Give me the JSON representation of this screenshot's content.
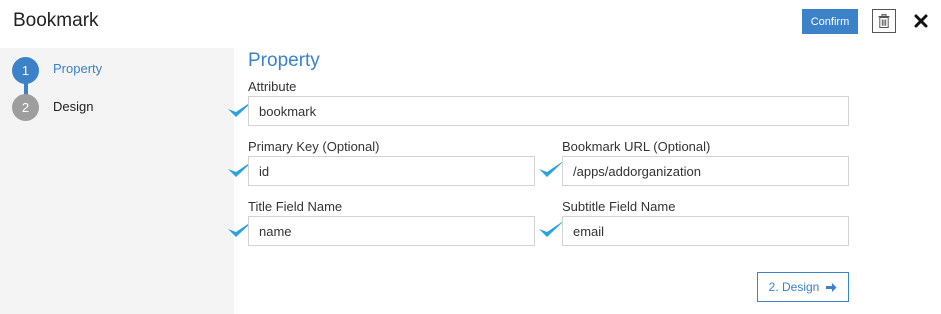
{
  "header": {
    "title": "Bookmark",
    "confirm_label": "Confirm",
    "trash_icon": "trash-icon",
    "close_icon": "close-icon"
  },
  "steps": [
    {
      "number": "1",
      "label": "Property",
      "active": true
    },
    {
      "number": "2",
      "label": "Design",
      "active": false
    }
  ],
  "form": {
    "section_title": "Property",
    "attribute": {
      "label": "Attribute",
      "value": "bookmark"
    },
    "primary_key": {
      "label": "Primary Key (Optional)",
      "value": "id"
    },
    "bookmark_url": {
      "label": "Bookmark URL (Optional)",
      "value": "/apps/addorganization"
    },
    "title_field": {
      "label": "Title Field Name",
      "value": "name"
    },
    "subtitle_field": {
      "label": "Subtitle Field Name",
      "value": "email"
    }
  },
  "next_button": {
    "label": "2. Design",
    "icon": "arrow-right-icon"
  },
  "colors": {
    "accent": "#3b82c8",
    "check": "#2aa3dc",
    "step_inactive": "#9e9e9e",
    "sidebar_bg": "#f4f4f4"
  }
}
